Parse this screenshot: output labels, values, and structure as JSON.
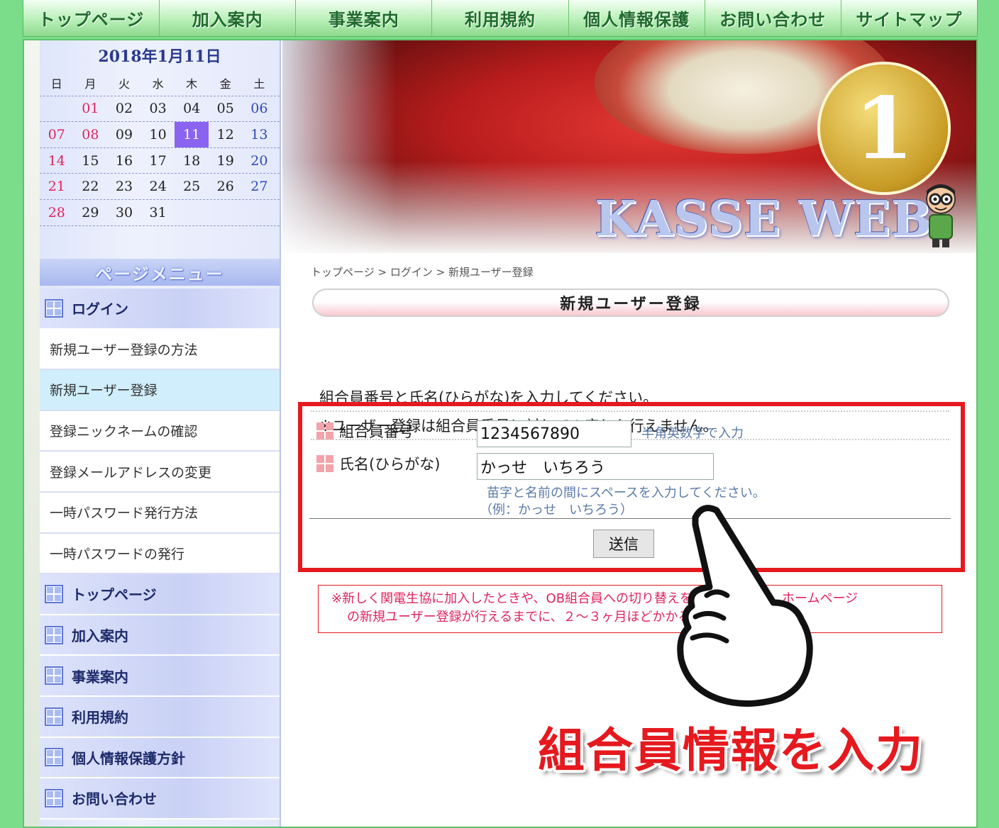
{
  "topnav": [
    "トップページ",
    "加入案内",
    "事業案内",
    "利用規約",
    "個人情報保護",
    "お問い合わせ",
    "サイトマップ"
  ],
  "calendar": {
    "title": "2018年1月11日",
    "weekdays": [
      "日",
      "月",
      "火",
      "水",
      "木",
      "金",
      "土"
    ],
    "weeks": [
      [
        "",
        "01",
        "02",
        "03",
        "04",
        "05",
        "06"
      ],
      [
        "07",
        "08",
        "09",
        "10",
        "11",
        "12",
        "13"
      ],
      [
        "14",
        "15",
        "16",
        "17",
        "18",
        "19",
        "20"
      ],
      [
        "21",
        "22",
        "23",
        "24",
        "25",
        "26",
        "27"
      ],
      [
        "28",
        "29",
        "30",
        "31",
        "",
        "",
        ""
      ]
    ],
    "today": "11",
    "holidays": [
      "01",
      "08"
    ]
  },
  "menu": {
    "title": "ページメニュー",
    "login_head": "ログイン",
    "sub_items": [
      "新規ユーザー登録の方法",
      "新規ユーザー登録",
      "登録ニックネームの確認",
      "登録メールアドレスの変更",
      "一時パスワード発行方法",
      "一時パスワードの発行"
    ],
    "active_sub": "新規ユーザー登録",
    "heads": [
      "トップページ",
      "加入案内",
      "事業案内",
      "利用規約",
      "個人情報保護方針",
      "お問い合わせ"
    ]
  },
  "banner": {
    "number": "1",
    "logo": "KASSE WEB"
  },
  "breadcrumb": {
    "home": "トップページ",
    "sep": " > ",
    "login": "ログイン",
    "current": "新規ユーザー登録"
  },
  "page_title": "新規ユーザー登録",
  "instructions": [
    "組合員番号と氏名(ひらがな)を入力してください。",
    "※ユーザー登録は組合員番号に対して１度しか行えません。"
  ],
  "form": {
    "member_label": "組合員番号",
    "member_value": "1234567890",
    "member_hint": "半角英数字で入力",
    "name_label": "氏名(ひらがな)",
    "name_value": "かっせ　いちろう",
    "name_hint": "苗字と名前の間にスペースを入力してください。",
    "name_example": "（例：かっせ　いちろう）",
    "submit": "送信"
  },
  "notice": {
    "line1": "※新しく関電生協に加入したときや、OB組合員への切り替えを行ったときは、ホームページ",
    "line2": "の新規ユーザー登録が行えるまでに、２～３ヶ月ほどかかる場合があります。"
  },
  "annotation": "組合員情報を入力",
  "colors": {
    "green": "#7bdc8a",
    "accent_red": "#e5191e",
    "today": "#8a63f0"
  }
}
